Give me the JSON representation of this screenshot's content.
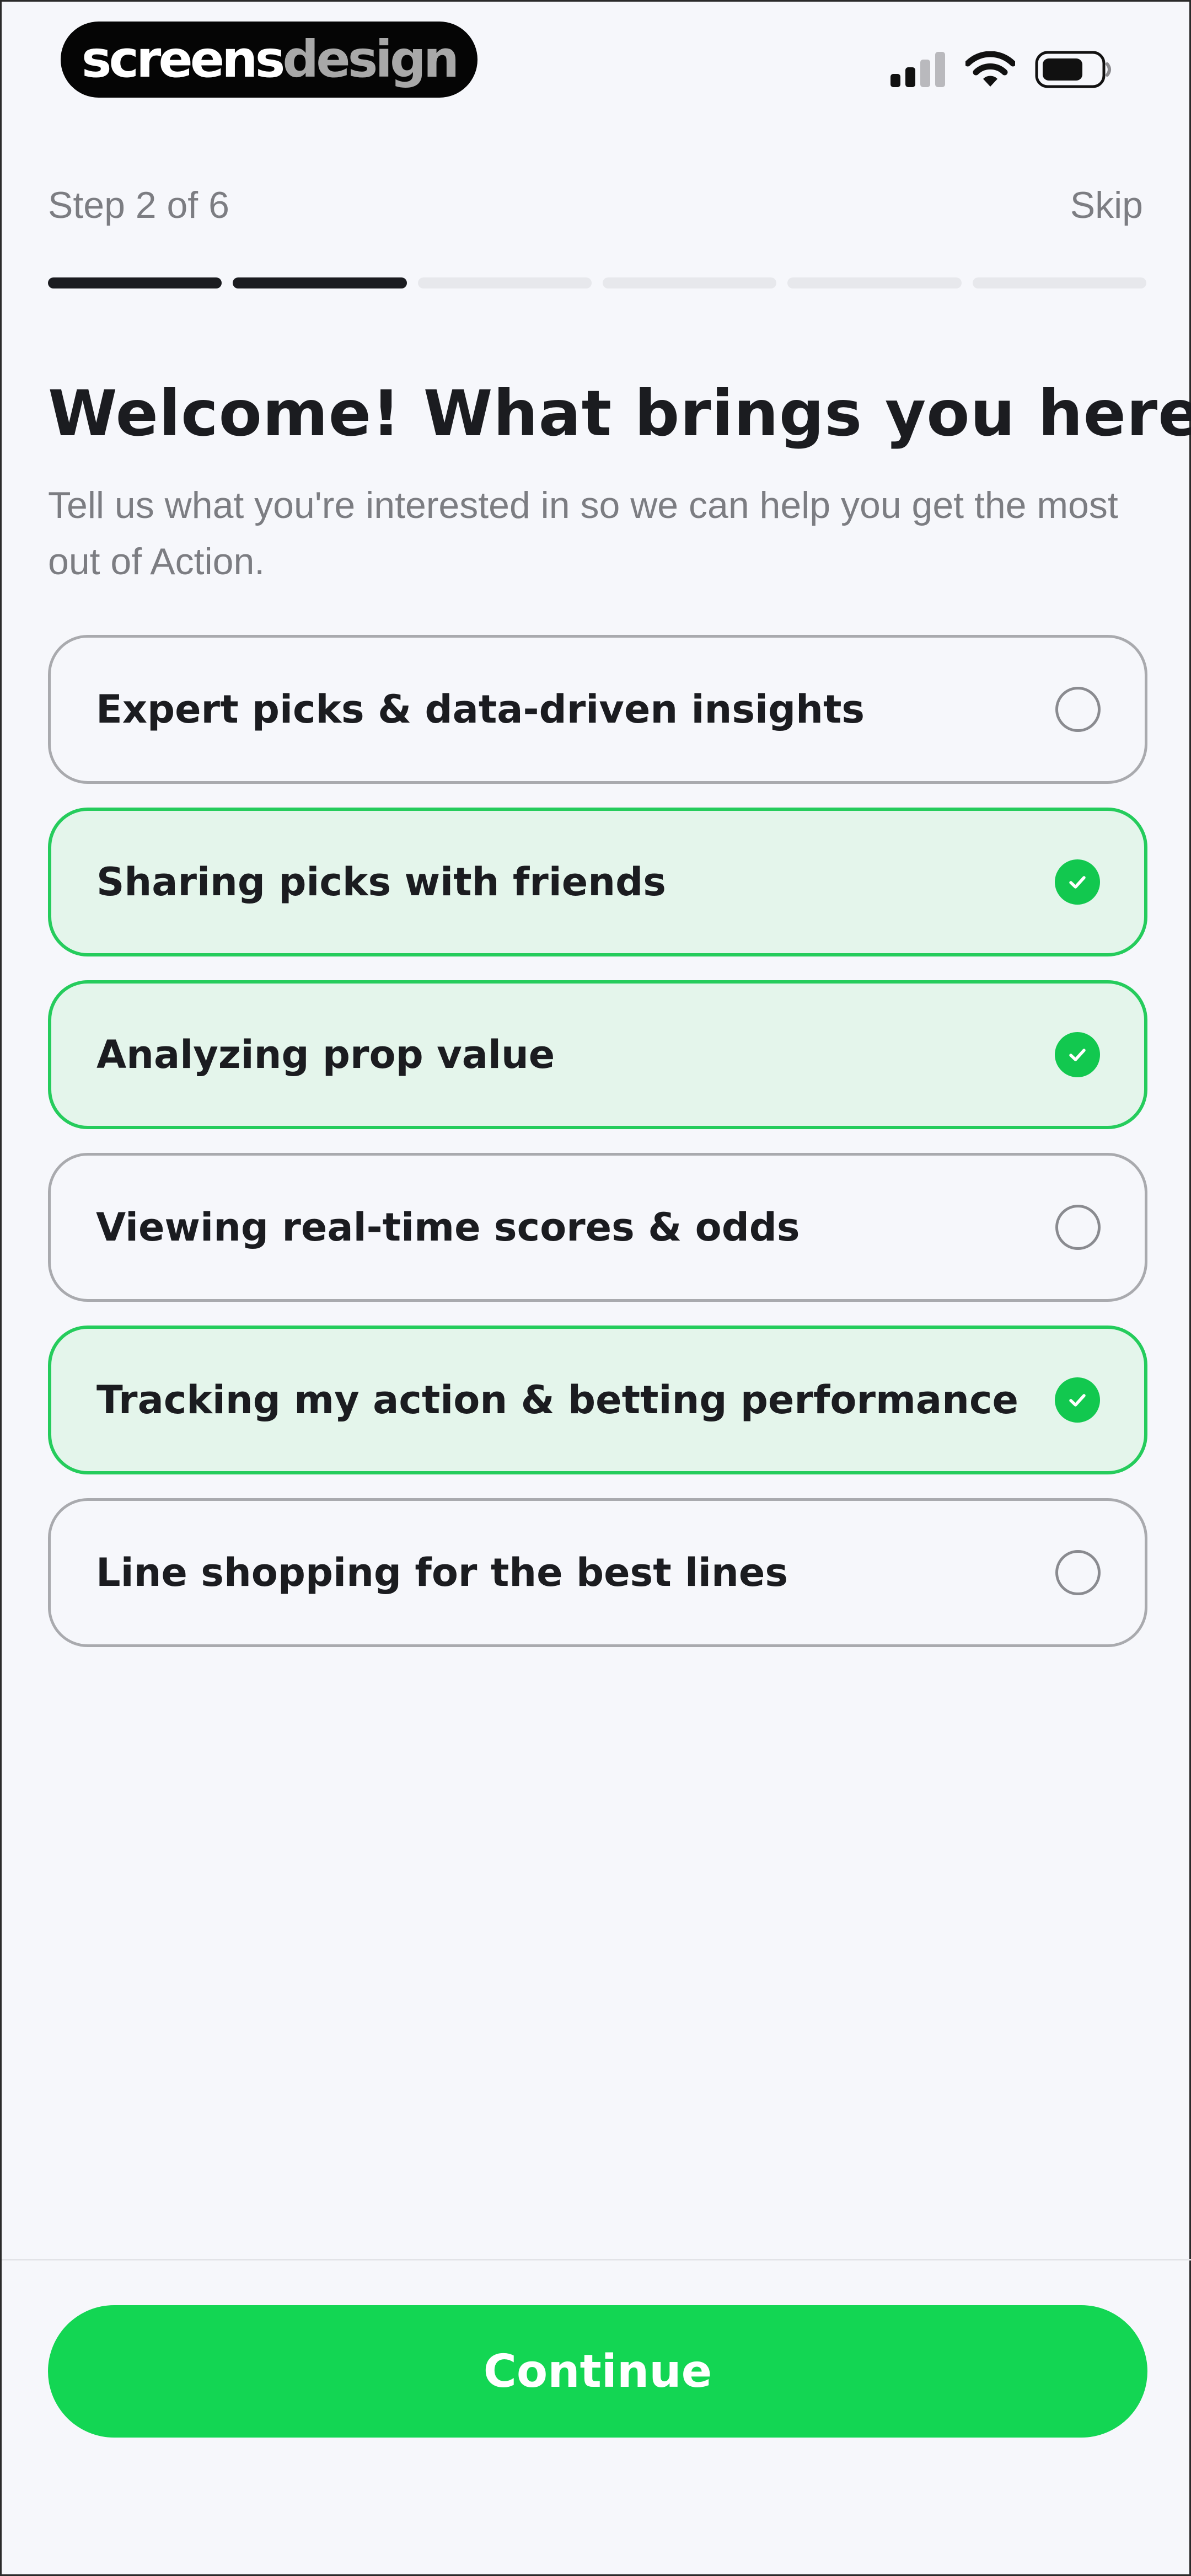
{
  "status_bar": {
    "brand": {
      "part1": "screens",
      "part2": "design"
    },
    "icons": [
      "cellular-signal-icon",
      "wifi-icon",
      "battery-icon"
    ]
  },
  "header": {
    "step_label": "Step 2 of 6",
    "skip_label": "Skip",
    "progress": {
      "current_step": 2,
      "total_steps": 6
    }
  },
  "title": "Welcome! What brings you here?",
  "subtitle": "Tell us what you're interested in so we can help you get the most out of Action.",
  "options": [
    {
      "label": "Expert picks & data-driven insights",
      "selected": false
    },
    {
      "label": "Sharing picks with friends",
      "selected": true
    },
    {
      "label": "Analyzing prop value",
      "selected": true
    },
    {
      "label": "Viewing real-time scores & odds",
      "selected": false
    },
    {
      "label": "Tracking my action & betting performance",
      "selected": true
    },
    {
      "label": "Line shopping for the best lines",
      "selected": false
    }
  ],
  "footer": {
    "continue_label": "Continue"
  },
  "colors": {
    "accent_green": "#13d653",
    "selected_border": "#25cc5c",
    "selected_fill": "#e4f5eb",
    "progress_done": "#1b1c20",
    "progress_todo": "#e7e8ec",
    "background": "#f6f7fb"
  }
}
